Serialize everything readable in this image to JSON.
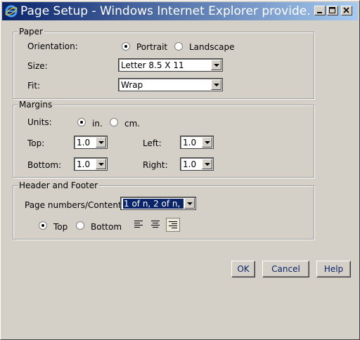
{
  "window": {
    "title": "Page Setup - Windows Internet Explorer provide..."
  },
  "paper": {
    "legend": "Paper",
    "orientation_label": "Orientation:",
    "portrait": "Portrait",
    "landscape": "Landscape",
    "orientation_selected": "Portrait",
    "size_label": "Size:",
    "size_value": "Letter 8.5 X 11",
    "fit_label": "Fit:",
    "fit_value": "Wrap"
  },
  "margins": {
    "legend": "Margins",
    "units_label": "Units:",
    "unit_in": "in.",
    "unit_cm": "cm.",
    "units_selected": "in.",
    "top_label": "Top:",
    "top_value": "1.0",
    "left_label": "Left:",
    "left_value": "1.0",
    "bottom_label": "Bottom:",
    "bottom_value": "1.0",
    "right_label": "Right:",
    "right_value": "1.0"
  },
  "header_footer": {
    "legend": "Header and Footer",
    "page_numbers_label": "Page numbers/Content:",
    "page_numbers_value": "1 of n, 2 of n, ...",
    "top": "Top",
    "bottom": "Bottom",
    "position_selected": "Top",
    "alignment_selected": "right"
  },
  "buttons": {
    "ok": "OK",
    "cancel": "Cancel",
    "help": "Help"
  }
}
